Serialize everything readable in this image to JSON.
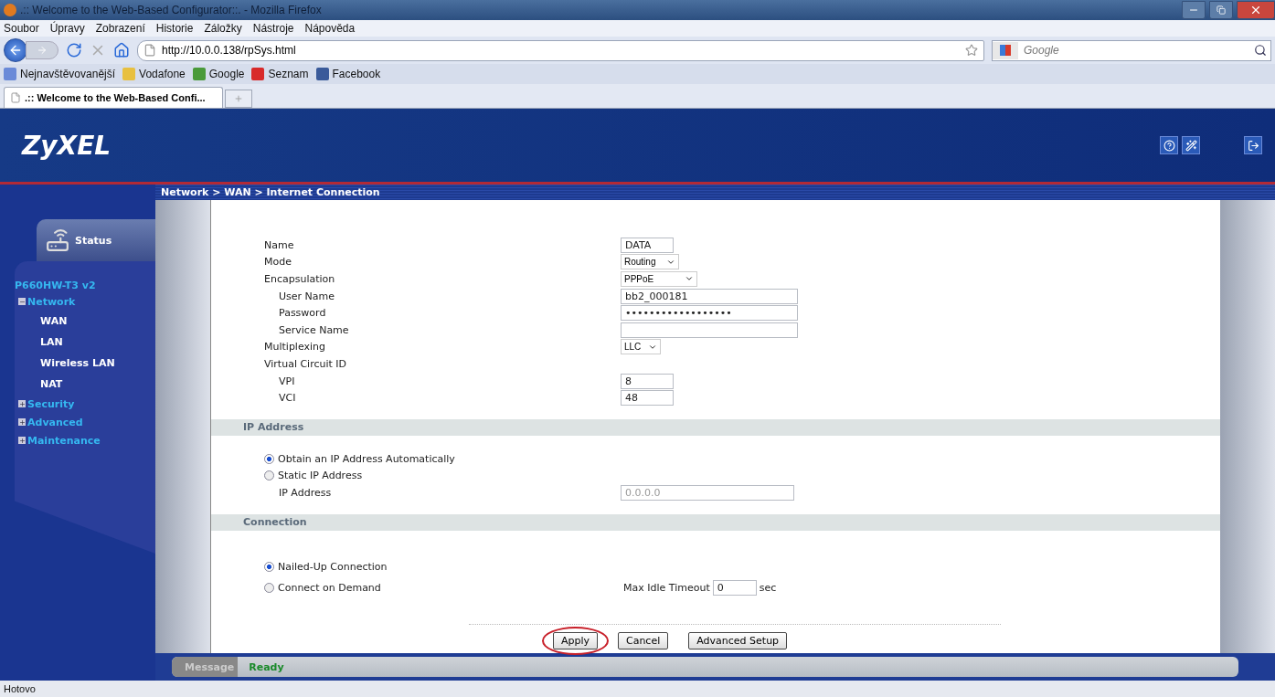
{
  "window": {
    "title": ".:: Welcome to the Web-Based Configurator::. - Mozilla Firefox"
  },
  "menu": [
    "Soubor",
    "Úpravy",
    "Zobrazení",
    "Historie",
    "Záložky",
    "Nástroje",
    "Nápověda"
  ],
  "address": "http://10.0.0.138/rpSys.html",
  "search": {
    "placeholder": "Google"
  },
  "bookmarks": [
    "Nejnavštěvovanější",
    "Vodafone",
    "Google",
    "Seznam",
    "Facebook"
  ],
  "tabs": [
    {
      "label": ".:: Welcome to the Web-Based Confi...",
      "selected": true
    }
  ],
  "logo": "ZyXEL",
  "breadcrumb": "Network > WAN > Internet Connection",
  "sidebar": {
    "status_tab": "Status",
    "model": "P660HW-T3 v2",
    "items": [
      {
        "label": "Network",
        "expanded": true,
        "children": [
          {
            "label": "WAN"
          },
          {
            "label": "LAN"
          },
          {
            "label": "Wireless LAN"
          },
          {
            "label": "NAT"
          }
        ]
      },
      {
        "label": "Security",
        "expanded": false
      },
      {
        "label": "Advanced",
        "expanded": false
      },
      {
        "label": "Maintenance",
        "expanded": false
      }
    ]
  },
  "fields": [
    {
      "kind": "text",
      "label": "Name",
      "value": "DATA",
      "indented": false
    },
    {
      "kind": "select",
      "label": "Mode",
      "value": "Routing",
      "indented": false
    },
    {
      "kind": "select",
      "label": "Encapsulation",
      "value": "PPPoE",
      "indented": false
    },
    {
      "kind": "text",
      "label": "User Name",
      "value": "bb2_000181",
      "indented": true
    },
    {
      "kind": "text",
      "label": "Password",
      "value": "••••••••••••••••••",
      "indented": true
    },
    {
      "kind": "text",
      "label": "Service Name",
      "indented": true
    },
    {
      "kind": "select",
      "label": "Multiplexing",
      "value": "LLC",
      "indented": false
    },
    {
      "kind": "label",
      "label": "Virtual Circuit ID",
      "indented": false
    },
    {
      "kind": "text",
      "label": "VPI",
      "value": "8",
      "indented": true
    },
    {
      "kind": "text",
      "label": "VCI",
      "value": "48",
      "indented": true
    }
  ],
  "ip_section": {
    "title": "IP Address",
    "options": [
      {
        "label": "Obtain an IP Address Automatically",
        "selected": true
      },
      {
        "label": "Static IP Address",
        "selected": false
      }
    ],
    "ip_label": "IP Address",
    "ip_value": "0.0.0.0",
    "ip_disabled": true
  },
  "connection_section": {
    "title": "Connection",
    "options": [
      {
        "label": "Nailed-Up Connection",
        "selected": true
      },
      {
        "label": "Connect on Demand",
        "selected": false
      }
    ],
    "timeout_label": "Max Idle Timeout",
    "timeout_value": "0",
    "timeout_unit": "sec"
  },
  "buttons": [
    {
      "label": "Apply",
      "circled": true
    },
    {
      "label": "Cancel",
      "circled": false
    },
    {
      "label": "Advanced Setup",
      "circled": false
    }
  ],
  "message": {
    "label": "Message",
    "value": "Ready"
  },
  "status_bar": "Hotovo"
}
